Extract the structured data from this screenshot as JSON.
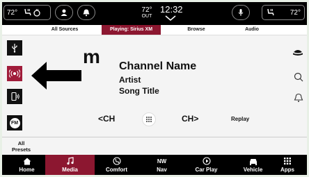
{
  "status": {
    "left_temp": "72°",
    "outside_temp": "72°",
    "outside_label": "OUT",
    "time": "12:32",
    "right_temp": "72°"
  },
  "tabs": [
    "All Sources",
    "Playing: Sirius XM",
    "Browse",
    "Audio"
  ],
  "now_playing": {
    "logo_letter": "m",
    "channel": "Channel Name",
    "artist": "Artist",
    "song": "Song Title"
  },
  "controls": {
    "ch_prev": "CH",
    "ch_next": "CH",
    "replay": "Replay"
  },
  "left_sources": {
    "fm_label": "FM"
  },
  "presets_label": "All\nPresets",
  "nav": [
    {
      "label": "Home",
      "icon": "home-icon"
    },
    {
      "label": "Media",
      "icon": "music-note-icon"
    },
    {
      "label": "Comfort",
      "icon": "comfort-icon"
    },
    {
      "label": "Nav",
      "icon": "compass-icon",
      "sub": "NW"
    },
    {
      "label": "Car Play",
      "icon": "carplay-icon"
    },
    {
      "label": "Vehicle",
      "icon": "car-icon"
    },
    {
      "label": "Apps",
      "icon": "apps-grid-icon"
    }
  ],
  "colors": {
    "accent": "#8c1730",
    "status_bar": "#000000",
    "background": "#f4f4f4"
  }
}
